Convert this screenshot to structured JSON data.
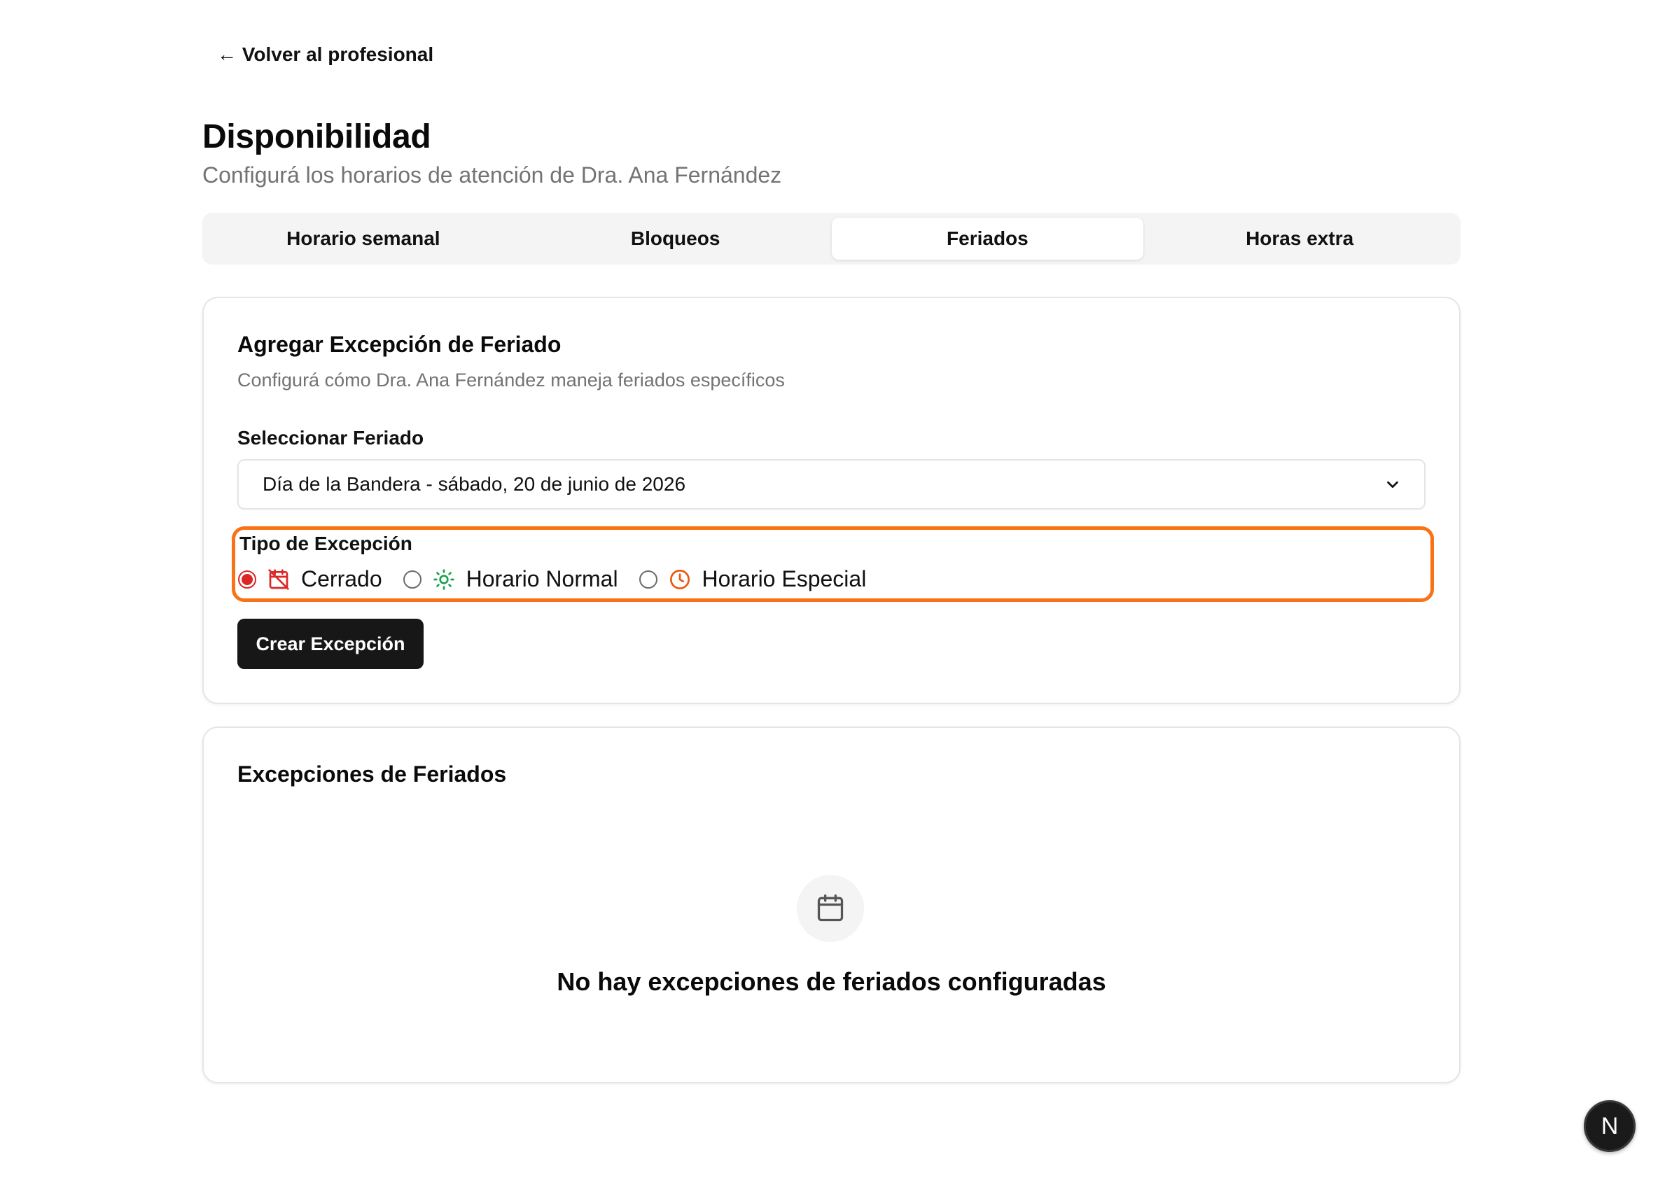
{
  "nav": {
    "back_label": "← Volver al profesional"
  },
  "header": {
    "title": "Disponibilidad",
    "subtitle": "Configurá los horarios de atención de Dra. Ana Fernández"
  },
  "tabs": [
    {
      "label": "Horario semanal",
      "active": false
    },
    {
      "label": "Bloqueos",
      "active": false
    },
    {
      "label": "Feriados",
      "active": true
    },
    {
      "label": "Horas extra",
      "active": false
    }
  ],
  "add_exception": {
    "title": "Agregar Excepción de Feriado",
    "description": "Configurá cómo Dra. Ana Fernández maneja feriados específicos",
    "select_label": "Seleccionar Feriado",
    "select_value": "Día de la Bandera - sábado, 20 de junio de 2026",
    "type_label": "Tipo de Excepción",
    "options": [
      {
        "label": "Cerrado",
        "checked": true,
        "icon": "calendar-x-icon",
        "color": "#dc2626"
      },
      {
        "label": "Horario Normal",
        "checked": false,
        "icon": "sun-icon",
        "color": "#16a34a"
      },
      {
        "label": "Horario Especial",
        "checked": false,
        "icon": "clock-icon",
        "color": "#ea580c"
      }
    ],
    "submit_label": "Crear Excepción"
  },
  "exceptions_list": {
    "title": "Excepciones de Feriados",
    "empty_text": "No hay excepciones de feriados configuradas",
    "empty_icon": "calendar-icon"
  },
  "dev_badge": {
    "label": "N"
  },
  "colors": {
    "highlight": "#f97316",
    "primary_button": "#171717",
    "muted_text": "#737373",
    "tab_bg": "#f4f4f5"
  }
}
